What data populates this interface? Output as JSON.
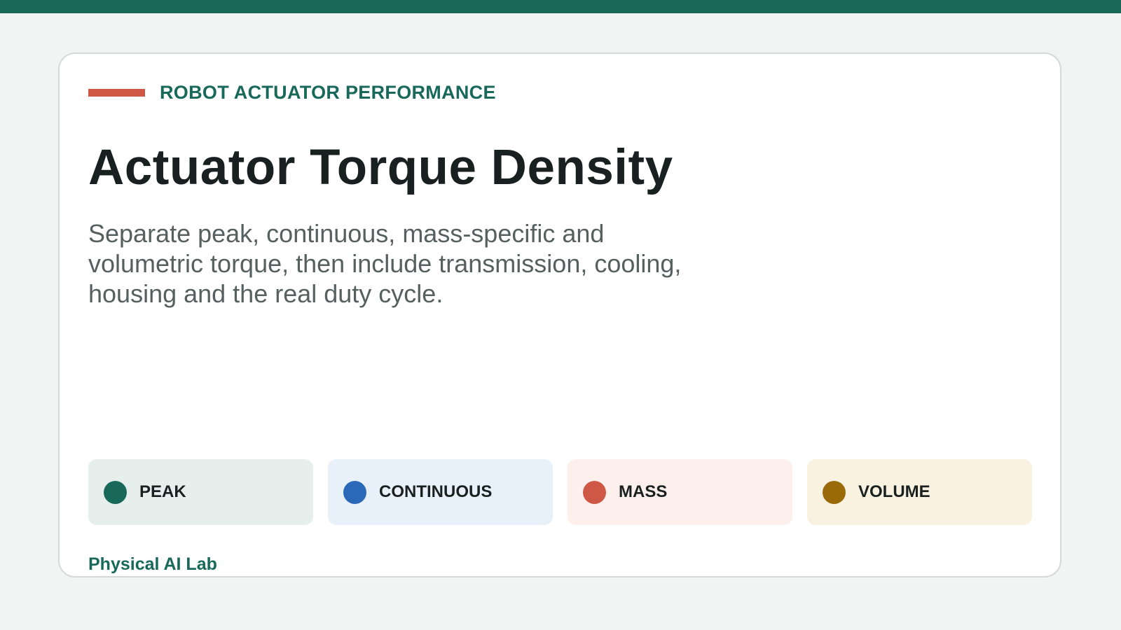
{
  "header": {
    "eyebrow": "ROBOT ACTUATOR PERFORMANCE",
    "title": "Actuator Torque Density",
    "subtitle": "Separate peak, continuous, mass-specific and volumetric torque, then include transmission, cooling, housing and the real duty cycle."
  },
  "categories": [
    {
      "label": "PEAK",
      "dot_color": "#18695a",
      "bg_color": "#e6efec"
    },
    {
      "label": "CONTINUOUS",
      "dot_color": "#2a68b8",
      "bg_color": "#e8f0fa"
    },
    {
      "label": "MASS",
      "dot_color": "#cf5745",
      "bg_color": "#fdefec"
    },
    {
      "label": "VOLUME",
      "dot_color": "#9a6a08",
      "bg_color": "#faf2e0"
    }
  ],
  "footer": {
    "brand": "Physical AI Lab"
  },
  "colors": {
    "accent": "#18695a",
    "rule": "#cf5745",
    "background": "#f2f4f3"
  }
}
